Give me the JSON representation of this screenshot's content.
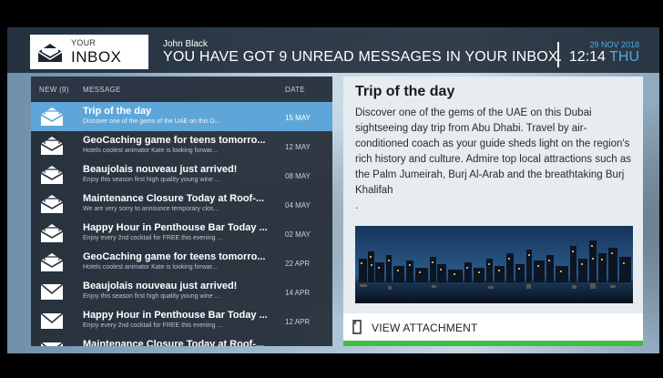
{
  "header": {
    "inbox_your": "YOUR",
    "inbox_title": "INBOX",
    "user_name": "John Black",
    "headline": "YOU HAVE GOT 9 UNREAD MESSAGES IN YOUR INBOX.",
    "date": "29 NOV 2018",
    "time": "12:14",
    "day": "THU"
  },
  "list": {
    "columns": {
      "new": "NEW (9)",
      "message": "MESSAGE",
      "date": "DATE"
    },
    "rows": [
      {
        "subject": "Trip of the day",
        "preview": "Discover one of the gems of the UAE on this D...",
        "date": "15 MAY",
        "icon": "envelope-open-icon"
      },
      {
        "subject": "GeoCaching game for teens tomorro...",
        "preview": "Hotels coolest animator Kate is looking forwar...",
        "date": "12 MAY",
        "icon": "envelope-open-icon"
      },
      {
        "subject": "Beaujolais nouveau just arrived!",
        "preview": "Enjoy this season first high quality young wine ...",
        "date": "08 MAY",
        "icon": "envelope-open-icon"
      },
      {
        "subject": "Maintenance Closure Today at Roof-...",
        "preview": "We are very sorry to announce temporary clos...",
        "date": "04 MAY",
        "icon": "envelope-open-icon"
      },
      {
        "subject": "Happy Hour in Penthouse Bar Today ...",
        "preview": "Enjoy every 2nd cocktail for FREE this evening ...",
        "date": "02 MAY",
        "icon": "envelope-open-icon"
      },
      {
        "subject": "GeoCaching game for teens tomorro...",
        "preview": "Hotels coolest animator Kate is looking forwar...",
        "date": "22 APR",
        "icon": "envelope-open-icon"
      },
      {
        "subject": "Beaujolais nouveau just arrived!",
        "preview": "Enjoy this season first high quality young wine ...",
        "date": "14 APR",
        "icon": "envelope-closed-icon"
      },
      {
        "subject": "Happy Hour in Penthouse Bar Today ...",
        "preview": "Enjoy every 2nd cocktail for FREE this evening ...",
        "date": "12 APR",
        "icon": "envelope-closed-icon"
      },
      {
        "subject": "Maintenance Closure Today at Roof-...",
        "preview": "",
        "date": "",
        "icon": "envelope-closed-icon"
      }
    ]
  },
  "detail": {
    "title": "Trip of the day",
    "body": "Discover one of the gems of the UAE on this Dubai sightseeing day trip from Abu Dhabi. Travel by air-conditioned coach as your guide sheds light on the region's rich history and culture. Admire top local attractions such as the Palm Jumeirah, Burj Al-Arab and the breathtaking Burj Khalifah",
    "body_end": ".",
    "attachment_label": "VIEW ATTACHMENT"
  },
  "colors": {
    "accent": "#5fa6d8",
    "clock_blue": "#52a9e8",
    "attach_green": "#3fbd43"
  }
}
